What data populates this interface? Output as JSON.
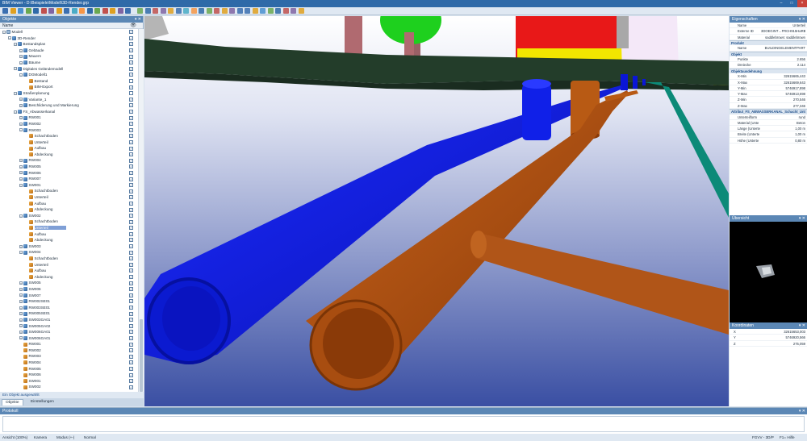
{
  "window": {
    "title": "BIM Viewer - D:\\Beispiele\\Modell\\3D-Render.grp"
  },
  "toolbar": {
    "icons": [
      "open-icon",
      "save-icon",
      "print-icon",
      "select-icon",
      "zoom-icon",
      "pan-icon",
      "rotate-icon",
      "measure-icon",
      "layer-icon",
      "section-icon",
      "render-icon",
      "home-icon",
      "view-icon",
      "camera-icon",
      "filter-icon",
      "settings-icon",
      "help-icon"
    ]
  },
  "objects_panel": {
    "title": "Objekte",
    "column_name": "Name",
    "status": "Ein Objekt ausgewählt",
    "tabs": [
      "Objekte",
      "Einstellungen"
    ]
  },
  "tree": [
    {
      "label": "Modell",
      "level": 0,
      "icon": "folder",
      "exp": "−",
      "checked": true
    },
    {
      "label": "3D-Render",
      "level": 1,
      "icon": "group",
      "exp": "−",
      "checked": true
    },
    {
      "label": "Bestandsplan",
      "level": 2,
      "icon": "group",
      "exp": "−",
      "checked": true
    },
    {
      "label": "Gebäude",
      "level": 3,
      "icon": "group",
      "exp": "+",
      "checked": true
    },
    {
      "label": "Mauern",
      "level": 3,
      "icon": "group",
      "exp": "+",
      "checked": true
    },
    {
      "label": "Bäume",
      "level": 3,
      "icon": "group",
      "exp": "+",
      "checked": true
    },
    {
      "label": "Digitales Geländemodell",
      "level": 2,
      "icon": "group",
      "exp": "−",
      "checked": true
    },
    {
      "label": "DGModell1",
      "level": 3,
      "icon": "group",
      "exp": "−",
      "checked": true
    },
    {
      "label": "Bestand",
      "level": 4,
      "icon": "part",
      "exp": "",
      "checked": false
    },
    {
      "label": "BIM-Export",
      "level": 4,
      "icon": "part",
      "exp": "",
      "checked": true
    },
    {
      "label": "Straßenplanung",
      "level": 2,
      "icon": "group",
      "exp": "−",
      "checked": false
    },
    {
      "label": "Variante_1",
      "level": 3,
      "icon": "group",
      "exp": "+",
      "checked": true
    },
    {
      "label": "Beschilderung und Markierung",
      "level": 3,
      "icon": "group",
      "exp": "+",
      "checked": true
    },
    {
      "label": "FS_Abwasserkanal",
      "level": 2,
      "icon": "group",
      "exp": "−",
      "checked": true
    },
    {
      "label": "RW001",
      "level": 3,
      "icon": "group",
      "exp": "+",
      "checked": true
    },
    {
      "label": "RW002",
      "level": 3,
      "icon": "group",
      "exp": "+",
      "checked": true
    },
    {
      "label": "RW003",
      "level": 3,
      "icon": "group",
      "exp": "−",
      "checked": true
    },
    {
      "label": "Schachtboden",
      "level": 4,
      "icon": "part",
      "exp": "",
      "checked": true
    },
    {
      "label": "Unterteil",
      "level": 4,
      "icon": "part",
      "exp": "",
      "checked": true
    },
    {
      "label": "Aufbau",
      "level": 4,
      "icon": "part",
      "exp": "",
      "checked": true
    },
    {
      "label": "Abdeckung",
      "level": 4,
      "icon": "part",
      "exp": "",
      "checked": true
    },
    {
      "label": "RW004",
      "level": 3,
      "icon": "group",
      "exp": "+",
      "checked": true
    },
    {
      "label": "RW005",
      "level": 3,
      "icon": "group",
      "exp": "+",
      "checked": true
    },
    {
      "label": "RW006",
      "level": 3,
      "icon": "group",
      "exp": "+",
      "checked": true
    },
    {
      "label": "RW007",
      "level": 3,
      "icon": "group",
      "exp": "+",
      "checked": true
    },
    {
      "label": "SW001",
      "level": 3,
      "icon": "group",
      "exp": "−",
      "checked": true
    },
    {
      "label": "Schachtboden",
      "level": 4,
      "icon": "part",
      "exp": "",
      "checked": true
    },
    {
      "label": "Unterteil",
      "level": 4,
      "icon": "part",
      "exp": "",
      "checked": true
    },
    {
      "label": "Aufbau",
      "level": 4,
      "icon": "part",
      "exp": "",
      "checked": true
    },
    {
      "label": "Abdeckung",
      "level": 4,
      "icon": "part",
      "exp": "",
      "checked": true
    },
    {
      "label": "SW002",
      "level": 3,
      "icon": "group",
      "exp": "−",
      "checked": true
    },
    {
      "label": "Schachtboden",
      "level": 4,
      "icon": "part",
      "exp": "",
      "checked": true
    },
    {
      "label": "Unterteil",
      "level": 4,
      "icon": "part",
      "exp": "",
      "checked": true,
      "selected": true
    },
    {
      "label": "Aufbau",
      "level": 4,
      "icon": "part",
      "exp": "",
      "checked": true
    },
    {
      "label": "Abdeckung",
      "level": 4,
      "icon": "part",
      "exp": "",
      "checked": true
    },
    {
      "label": "SW003",
      "level": 3,
      "icon": "group",
      "exp": "+",
      "checked": true
    },
    {
      "label": "SW004",
      "level": 3,
      "icon": "group",
      "exp": "−",
      "checked": true
    },
    {
      "label": "Schachtboden",
      "level": 4,
      "icon": "part",
      "exp": "",
      "checked": true
    },
    {
      "label": "Unterteil",
      "level": 4,
      "icon": "part",
      "exp": "",
      "checked": true
    },
    {
      "label": "Aufbau",
      "level": 4,
      "icon": "part",
      "exp": "",
      "checked": true
    },
    {
      "label": "Abdeckung",
      "level": 4,
      "icon": "part",
      "exp": "",
      "checked": true
    },
    {
      "label": "SW005",
      "level": 3,
      "icon": "group",
      "exp": "+",
      "checked": true
    },
    {
      "label": "SW006",
      "level": 3,
      "icon": "group",
      "exp": "+",
      "checked": true
    },
    {
      "label": "SW007",
      "level": 3,
      "icon": "group",
      "exp": "+",
      "checked": true
    },
    {
      "label": "RW002SE01",
      "level": 3,
      "icon": "group",
      "exp": "+",
      "checked": true
    },
    {
      "label": "RW003SE01",
      "level": 3,
      "icon": "group",
      "exp": "+",
      "checked": true
    },
    {
      "label": "RW005SE01",
      "level": 3,
      "icon": "group",
      "exp": "+",
      "checked": true
    },
    {
      "label": "SW003GA01",
      "level": 3,
      "icon": "group",
      "exp": "+",
      "checked": true
    },
    {
      "label": "SW005GA02",
      "level": 3,
      "icon": "group",
      "exp": "+",
      "checked": true
    },
    {
      "label": "SW006GA01",
      "level": 3,
      "icon": "group",
      "exp": "+",
      "checked": true
    },
    {
      "label": "SW006GA01",
      "level": 3,
      "icon": "group",
      "exp": "+",
      "checked": true
    },
    {
      "label": "RW001",
      "level": 3,
      "icon": "part",
      "exp": "",
      "checked": true
    },
    {
      "label": "RW002",
      "level": 3,
      "icon": "part",
      "exp": "",
      "checked": true
    },
    {
      "label": "RW003",
      "level": 3,
      "icon": "part",
      "exp": "",
      "checked": true
    },
    {
      "label": "RW004",
      "level": 3,
      "icon": "part",
      "exp": "",
      "checked": true
    },
    {
      "label": "RW005",
      "level": 3,
      "icon": "part",
      "exp": "",
      "checked": true
    },
    {
      "label": "RW006",
      "level": 3,
      "icon": "part",
      "exp": "",
      "checked": true
    },
    {
      "label": "SW001",
      "level": 3,
      "icon": "part",
      "exp": "",
      "checked": true
    },
    {
      "label": "SW002",
      "level": 3,
      "icon": "part",
      "exp": "",
      "checked": true
    }
  ],
  "properties": {
    "title": "Eigenschaften",
    "sections": [
      {
        "name": "",
        "rows": [
          [
            "Name",
            "Unterteil"
          ],
          [
            "Externe ID",
            "3DOEGINT…FRCH915HaRB1"
          ],
          [
            "Material",
            "saddlebrown: saddlebrown"
          ]
        ]
      },
      {
        "name": "Produkt",
        "rows": [
          [
            "Name",
            "BUILDINGELEMENTPART"
          ]
        ]
      },
      {
        "name": "Objekt",
        "rows": [
          [
            "Punkte",
            "2.656"
          ],
          [
            "Dreiecke",
            "2.114"
          ]
        ]
      },
      {
        "name": "Objektausdehnung",
        "rows": [
          [
            "X-Min",
            "32615665,443"
          ],
          [
            "X-Max",
            "32615669,643"
          ],
          [
            "Y-Min",
            "5746917,898"
          ],
          [
            "Y-Max",
            "5746913,698"
          ],
          [
            "Z-Min",
            "270,546"
          ],
          [
            "Z-Max",
            "277,346"
          ]
        ]
      },
      {
        "name": "Attribut_FS_ABWASSERKANAL_Schacht_Unt",
        "rows": [
          [
            "Unterteilform",
            "rund"
          ],
          [
            "Material (Unte",
            "Beton"
          ],
          [
            "Länge (Unterte",
            "1,00 m"
          ],
          [
            "Breite (Unterte",
            "1,00 m"
          ],
          [
            "Höhe (Unterte",
            "0,80 m"
          ]
        ]
      }
    ]
  },
  "overview": {
    "title": "Übersicht"
  },
  "coordinates": {
    "title": "Koordinaten",
    "rows": [
      [
        "X",
        "32615653,003"
      ],
      [
        "Y",
        "5746920,566"
      ],
      [
        "Z",
        "275,059"
      ]
    ]
  },
  "protocol": {
    "title": "Protokoll"
  },
  "statusbar": {
    "view": "Ansicht (100%)",
    "camera": "Kamera",
    "mode": "Modus (+-)",
    "render": "Normal",
    "coord": "FGVV - 3D/P",
    "help": "F1= Hilfe"
  },
  "colors": {
    "accent": "#2f6aa8",
    "pipe_blue": "#0a16d6",
    "pipe_brown": "#a84d10",
    "terrain": "#233d2a",
    "sky_top": "#ffffff",
    "sky_bottom": "#3a4fa3"
  }
}
